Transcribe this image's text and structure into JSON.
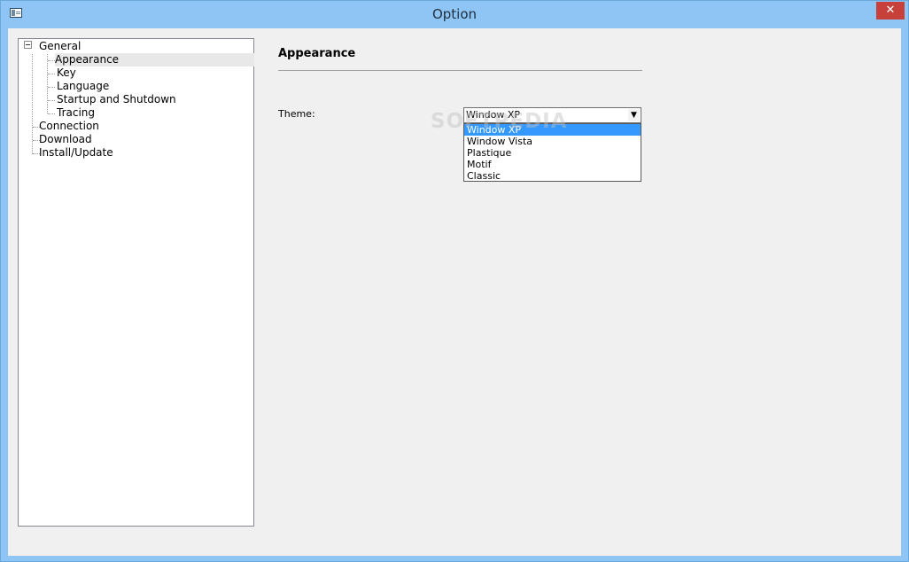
{
  "window": {
    "title": "Option",
    "close_glyph": "✕"
  },
  "tree": {
    "items": [
      {
        "label": "General",
        "level": 0,
        "expanded": true
      },
      {
        "label": "Appearance",
        "level": 1,
        "selected": true
      },
      {
        "label": "Key",
        "level": 1
      },
      {
        "label": "Language",
        "level": 1
      },
      {
        "label": "Startup and Shutdown",
        "level": 1
      },
      {
        "label": "Tracing",
        "level": 1
      },
      {
        "label": "Connection",
        "level": 0
      },
      {
        "label": "Download",
        "level": 0
      },
      {
        "label": "Install/Update",
        "level": 0
      }
    ]
  },
  "content": {
    "title": "Appearance",
    "theme_label": "Theme:",
    "theme_selected": "Window XP",
    "theme_options": [
      "Window XP",
      "Window Vista",
      "Plastique",
      "Motif",
      "Classic"
    ],
    "dropdown_arrow": "▼"
  },
  "watermark": "SOFTPEDIA",
  "colors": {
    "selection": "#3399ff",
    "close": "#c7413a",
    "frame": "#8ec5f4"
  }
}
